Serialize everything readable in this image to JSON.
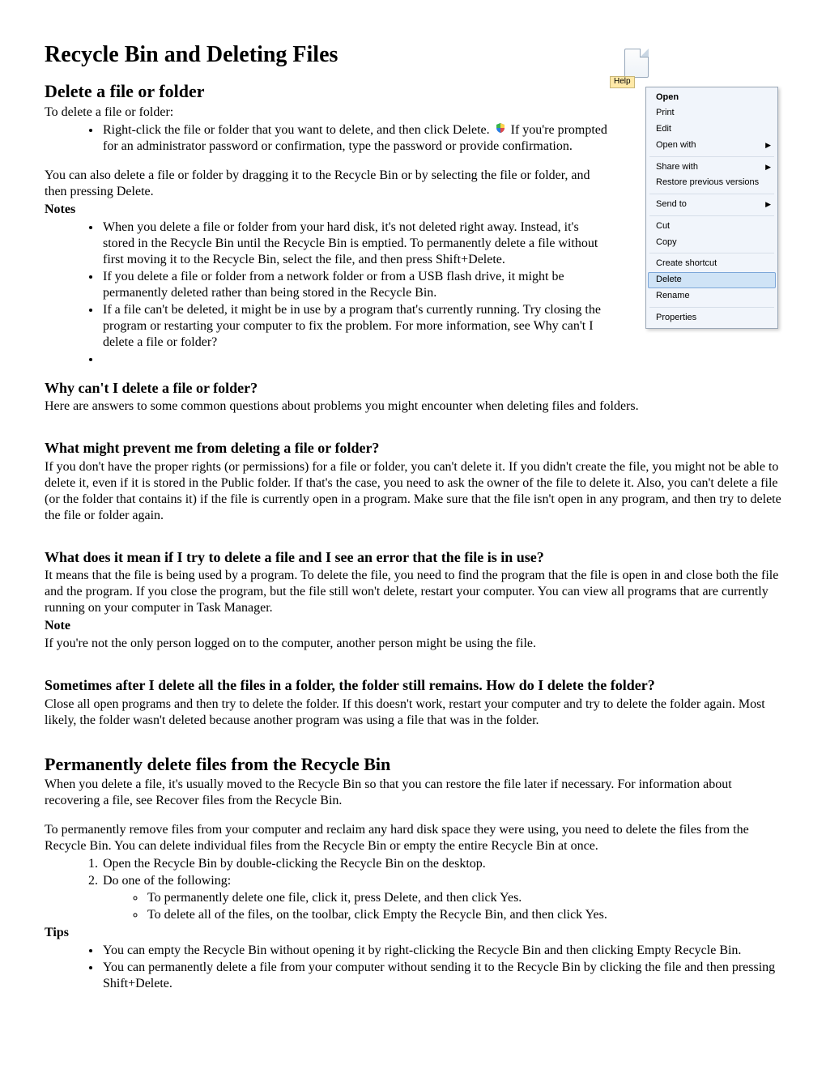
{
  "title": "Recycle Bin and Deleting Files",
  "s1": {
    "heading": "Delete a file or folder",
    "intro": "To delete a file or folder:",
    "bullet_pre": "Right-click the file or folder that you want to delete, and then click Delete. ",
    "bullet_post": " If you're prompted for an administrator password or confirmation, type the password or provide confirmation.",
    "para2": "You can also delete a file or folder by dragging it to the Recycle Bin or by selecting the file or folder, and then pressing Delete.",
    "notes_label": "Notes",
    "notes": [
      "When you delete a file or folder from your hard disk, it's not deleted right away. Instead, it's stored in the Recycle Bin until the Recycle Bin is emptied. To permanently delete a file without first moving it to the Recycle Bin, select the file, and then press Shift+Delete.",
      "If you delete a file or folder from a network folder or from a USB flash drive, it might be permanently deleted rather than being stored in the Recycle Bin.",
      "If a file can't be deleted, it might be in use by a program that's currently running. Try closing the program or restarting your computer to fix the problem. For more information, see Why can't I delete a file or folder?",
      ""
    ]
  },
  "s2": {
    "heading": "Why can't I delete a file or folder?",
    "intro": "Here are answers to some common questions about problems you might encounter when deleting files and folders.",
    "q1": {
      "heading": "What might prevent me from deleting a file or folder?",
      "body": "If you don't have the proper rights (or permissions) for a file or folder, you can't delete it. If you didn't create the file, you might not be able to delete it, even if it is stored in the Public folder. If that's the case, you need to ask the owner of the file to delete it.  Also, you can't delete a file (or the folder that contains it) if the file is currently open in a program. Make sure that the file isn't open in any program, and then try to delete the file or folder again."
    },
    "q2": {
      "heading": "What does it mean if I try to delete a file and I see an error that the file is in use?",
      "body": "It means that the file is being used by a program. To delete the file, you need to find the program that the file is open in and close both the file and the program. If you close the program, but the file still won't delete, restart your computer. You can view all programs that are currently running on your computer in Task Manager.",
      "note_label": "Note",
      "note_body": "If you're not the only person logged on to the computer, another person might be using the file."
    },
    "q3": {
      "heading": "Sometimes after I delete all the files in a folder, the folder still remains. How do I delete the folder?",
      "body": "Close all open programs and then try to delete the folder. If this doesn't work, restart your computer and try to delete the folder again. Most likely, the folder wasn't deleted because another program was using a file that was in the folder."
    }
  },
  "s3": {
    "heading": "Permanently delete files from the Recycle Bin",
    "p1": "When you delete a file, it's usually moved to the Recycle Bin so that you can restore the file later if necessary. For information about recovering a file, see Recover files from the Recycle Bin.",
    "p2": "To permanently remove files from your computer and reclaim any hard disk space they were using, you need to delete the files from the Recycle Bin. You can delete individual files from the Recycle Bin or empty the entire Recycle Bin at once.",
    "steps": [
      "Open the Recycle Bin by double-clicking the Recycle Bin on the desktop.",
      "Do one of the following:"
    ],
    "substeps": [
      "To permanently delete one file, click it, press Delete, and then click Yes.",
      "To delete all of the files, on the toolbar, click Empty the Recycle Bin, and then click Yes."
    ],
    "tips_label": "Tips",
    "tips": [
      "You can empty the Recycle Bin without opening it by right-clicking the Recycle Bin and then clicking Empty Recycle Bin.",
      "You can permanently delete a file from your computer without sending it to the Recycle Bin by clicking the file and then pressing Shift+Delete."
    ]
  },
  "ctx": {
    "help_tag": "Help",
    "items": [
      {
        "label": "Open",
        "bold": true
      },
      {
        "label": "Print"
      },
      {
        "label": "Edit"
      },
      {
        "label": "Open with",
        "arrow": true
      },
      {
        "sep": true
      },
      {
        "label": "Share with",
        "arrow": true
      },
      {
        "label": "Restore previous versions"
      },
      {
        "sep": true
      },
      {
        "label": "Send to",
        "arrow": true
      },
      {
        "sep": true
      },
      {
        "label": "Cut"
      },
      {
        "label": "Copy"
      },
      {
        "sep": true
      },
      {
        "label": "Create shortcut"
      },
      {
        "label": "Delete",
        "selected": true
      },
      {
        "label": "Rename"
      },
      {
        "sep": true
      },
      {
        "label": "Properties"
      }
    ]
  }
}
